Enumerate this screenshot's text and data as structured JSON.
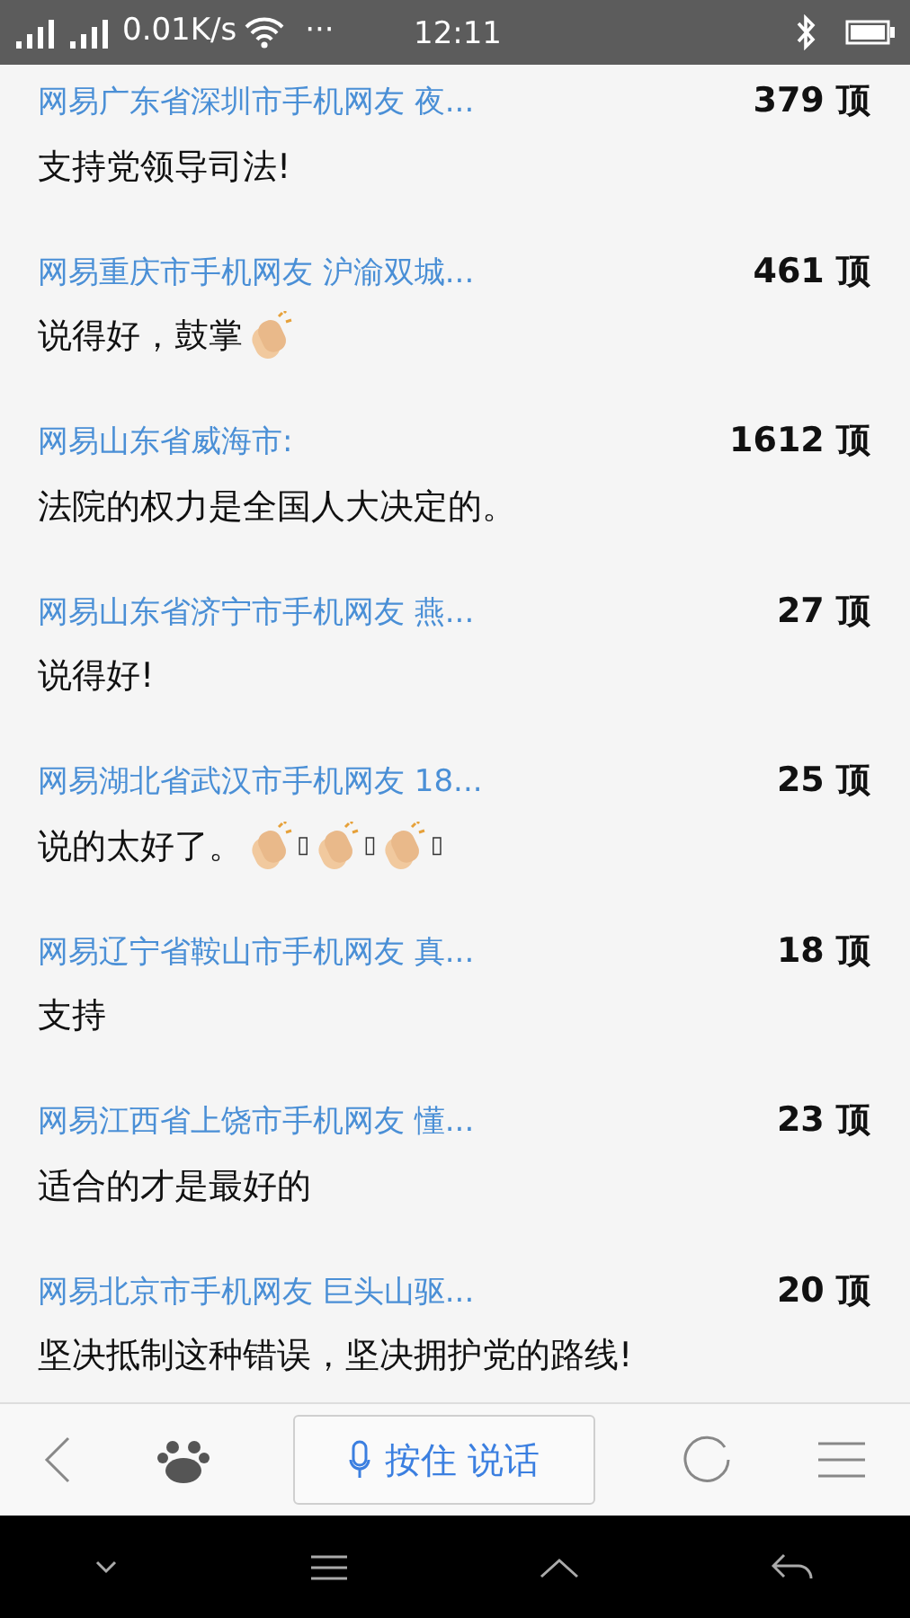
{
  "status_bar": {
    "speed": "0.01K/s",
    "more": "···",
    "time": "12:11"
  },
  "comments": [
    {
      "author": "网易广东省深圳市手机网友 夜...",
      "votes": "379 顶",
      "parts": [
        {
          "kind": "text",
          "text": "支持党领导司法!"
        }
      ]
    },
    {
      "author": "网易重庆市手机网友 沪渝双城...",
      "votes": "461 顶",
      "parts": [
        {
          "kind": "text",
          "text": "说得好，鼓掌"
        },
        {
          "kind": "clap"
        }
      ]
    },
    {
      "author": "网易山东省威海市:",
      "votes": "1612 顶",
      "parts": [
        {
          "kind": "text",
          "text": "法院的权力是全国人大决定的。"
        }
      ]
    },
    {
      "author": "网易山东省济宁市手机网友 燕...",
      "votes": "27 顶",
      "parts": [
        {
          "kind": "text",
          "text": "说得好!"
        }
      ]
    },
    {
      "author": "网易湖北省武汉市手机网友 18...",
      "votes": "25 顶",
      "parts": [
        {
          "kind": "text",
          "text": "说的太好了。"
        },
        {
          "kind": "clap"
        },
        {
          "kind": "missing",
          "text": "▯"
        },
        {
          "kind": "clap"
        },
        {
          "kind": "missing",
          "text": "▯"
        },
        {
          "kind": "clap"
        },
        {
          "kind": "missing",
          "text": "▯"
        }
      ]
    },
    {
      "author": "网易辽宁省鞍山市手机网友 真...",
      "votes": "18 顶",
      "parts": [
        {
          "kind": "text",
          "text": "支持"
        }
      ]
    },
    {
      "author": "网易江西省上饶市手机网友 懂...",
      "votes": "23 顶",
      "parts": [
        {
          "kind": "text",
          "text": "适合的才是最好的"
        }
      ]
    },
    {
      "author": "网易北京市手机网友 巨头山驱...",
      "votes": "20 顶",
      "parts": [
        {
          "kind": "text",
          "text": "坚决抵制这种错误，坚决拥护党的路线!"
        }
      ]
    }
  ],
  "toolbar": {
    "voice_button": "按住 说话"
  }
}
